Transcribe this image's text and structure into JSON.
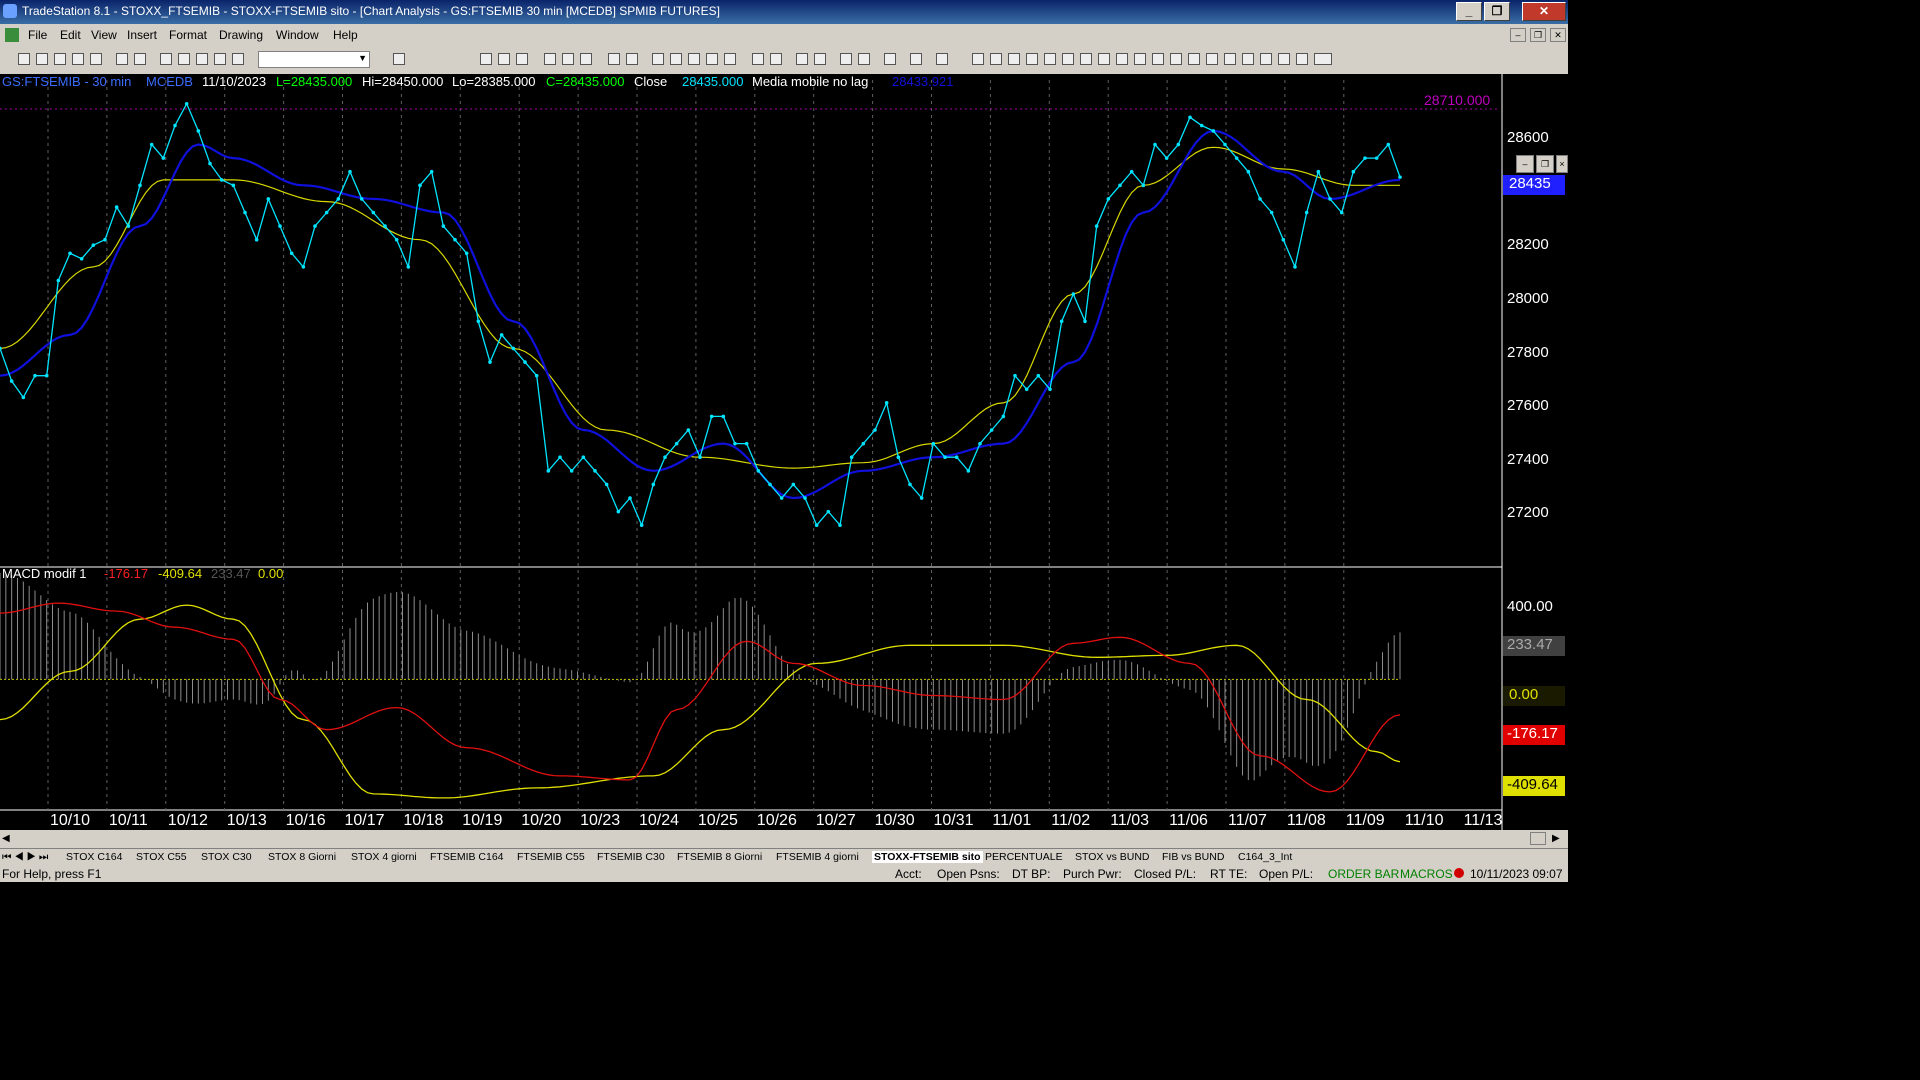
{
  "window": {
    "title": "TradeStation 8.1 - STOXX_FTSEMIB - STOXX-FTSEMIB sito - [Chart Analysis - GS:FTSEMIB  30 min  [MCEDB] SPMIB FUTURES]"
  },
  "menu": [
    "File",
    "Edit",
    "View",
    "Insert",
    "Format",
    "Drawing",
    "Window",
    "Help"
  ],
  "price_header": {
    "symbol": "GS:FTSEMIB - 30 min",
    "exchange": "MCEDB",
    "date": "11/10/2023",
    "last": "L=28435.000",
    "high": "Hi=28450.000",
    "low": "Lo=28385.000",
    "close": "C=28435.000",
    "close_label": "Close",
    "close_value": "28435.000",
    "ma_label": "Media mobile no lag",
    "ma_value": "28433.921"
  },
  "macd_header": {
    "label": "MACD modif 1",
    "v1": "-176.17",
    "v2": "-409.64",
    "v3": "233.47",
    "v4": "0.00"
  },
  "price_axis": {
    "labels": [
      "28600",
      "28400",
      "28200",
      "28000",
      "27800",
      "27600",
      "27400",
      "27200"
    ],
    "top_marker": "28710.000",
    "current": "28435"
  },
  "macd_axis": {
    "labels": [
      "400.00"
    ],
    "badges": {
      "hist": "233.47",
      "zero": "0.00",
      "macd": "-176.17",
      "signal": "-409.64"
    }
  },
  "time_axis": [
    "10/10",
    "10/11",
    "10/12",
    "10/13",
    "10/16",
    "10/17",
    "10/18",
    "10/19",
    "10/20",
    "10/23",
    "10/24",
    "10/25",
    "10/26",
    "10/27",
    "10/30",
    "10/31",
    "11/01",
    "11/02",
    "11/03",
    "11/06",
    "11/07",
    "11/08",
    "11/09",
    "11/10",
    "11/13"
  ],
  "tabs": [
    "STOX C164",
    "STOX C55",
    "STOX  C30",
    "STOX  8 Giorni",
    "STOX 4 giorni",
    "FTSEMIB C164",
    "FTSEMIB C55",
    "FTSEMIB C30",
    "FTSEMIB  8 Giorni",
    "FTSEMIB  4 giorni",
    "STOXX-FTSEMIB sito",
    "PERCENTUALE",
    "STOX vs BUND",
    "FIB vs BUND",
    "C164_3_Int"
  ],
  "active_tab": "STOXX-FTSEMIB sito",
  "status": {
    "help": "For Help, press F1",
    "acct": "Acct:",
    "open_psns": "Open Psns:",
    "dt_bp": "DT BP:",
    "purch_pwr": "Purch Pwr:",
    "closed_pl": "Closed P/L:",
    "rt_te": "RT TE:",
    "open_pl": "Open P/L:",
    "order_bar": "ORDER BAR",
    "macros": "MACROS",
    "datetime": "10/11/2023 09:07"
  },
  "colors": {
    "price": "#00e5ff",
    "ma_fast": "#1010dd",
    "ma_slow": "#d8d800",
    "macd": "#e01010",
    "signal": "#e0e000",
    "hist": "#8c8c8c",
    "header_symbol": "#3c6cff"
  },
  "chart_data": {
    "type": "line",
    "price_anchors": [
      [
        0,
        27800
      ],
      [
        1,
        27680
      ],
      [
        2,
        27620
      ],
      [
        3,
        27700
      ],
      [
        4,
        27700
      ],
      [
        5,
        28050
      ],
      [
        6,
        28150
      ],
      [
        7,
        28130
      ],
      [
        8,
        28180
      ],
      [
        9,
        28200
      ],
      [
        10,
        28320
      ],
      [
        11,
        28250
      ],
      [
        12,
        28400
      ],
      [
        13,
        28550
      ],
      [
        14,
        28500
      ],
      [
        15,
        28620
      ],
      [
        16,
        28700
      ],
      [
        17,
        28600
      ],
      [
        18,
        28480
      ],
      [
        19,
        28420
      ],
      [
        20,
        28400
      ],
      [
        21,
        28300
      ],
      [
        22,
        28200
      ],
      [
        23,
        28350
      ],
      [
        24,
        28250
      ],
      [
        25,
        28150
      ],
      [
        26,
        28100
      ],
      [
        27,
        28250
      ],
      [
        28,
        28300
      ],
      [
        29,
        28350
      ],
      [
        30,
        28450
      ],
      [
        31,
        28350
      ],
      [
        32,
        28300
      ],
      [
        33,
        28250
      ],
      [
        34,
        28200
      ],
      [
        35,
        28100
      ],
      [
        36,
        28400
      ],
      [
        37,
        28450
      ],
      [
        38,
        28250
      ],
      [
        39,
        28200
      ],
      [
        40,
        28150
      ],
      [
        41,
        27900
      ],
      [
        42,
        27750
      ],
      [
        43,
        27850
      ],
      [
        44,
        27800
      ],
      [
        45,
        27750
      ],
      [
        46,
        27700
      ],
      [
        47,
        27350
      ],
      [
        48,
        27400
      ],
      [
        49,
        27350
      ],
      [
        50,
        27400
      ],
      [
        51,
        27350
      ],
      [
        52,
        27300
      ],
      [
        53,
        27200
      ],
      [
        54,
        27250
      ],
      [
        55,
        27150
      ],
      [
        56,
        27300
      ],
      [
        57,
        27400
      ],
      [
        58,
        27450
      ],
      [
        59,
        27500
      ],
      [
        60,
        27400
      ],
      [
        61,
        27550
      ],
      [
        62,
        27550
      ],
      [
        63,
        27450
      ],
      [
        64,
        27450
      ],
      [
        65,
        27350
      ],
      [
        66,
        27300
      ],
      [
        67,
        27250
      ],
      [
        68,
        27300
      ],
      [
        69,
        27250
      ],
      [
        70,
        27150
      ],
      [
        71,
        27200
      ],
      [
        72,
        27150
      ],
      [
        73,
        27400
      ],
      [
        74,
        27450
      ],
      [
        75,
        27500
      ],
      [
        76,
        27600
      ],
      [
        77,
        27400
      ],
      [
        78,
        27300
      ],
      [
        79,
        27250
      ],
      [
        80,
        27450
      ],
      [
        81,
        27400
      ],
      [
        82,
        27400
      ],
      [
        83,
        27350
      ],
      [
        84,
        27450
      ],
      [
        85,
        27500
      ],
      [
        86,
        27550
      ],
      [
        87,
        27700
      ],
      [
        88,
        27650
      ],
      [
        89,
        27700
      ],
      [
        90,
        27650
      ],
      [
        91,
        27900
      ],
      [
        92,
        28000
      ],
      [
        93,
        27900
      ],
      [
        94,
        28250
      ],
      [
        95,
        28350
      ],
      [
        96,
        28400
      ],
      [
        97,
        28450
      ],
      [
        98,
        28400
      ],
      [
        99,
        28550
      ],
      [
        100,
        28500
      ],
      [
        101,
        28550
      ],
      [
        102,
        28650
      ],
      [
        103,
        28620
      ],
      [
        104,
        28600
      ],
      [
        105,
        28550
      ],
      [
        106,
        28500
      ],
      [
        107,
        28450
      ],
      [
        108,
        28350
      ],
      [
        109,
        28300
      ],
      [
        110,
        28200
      ],
      [
        111,
        28100
      ],
      [
        112,
        28300
      ],
      [
        113,
        28450
      ],
      [
        114,
        28350
      ],
      [
        115,
        28300
      ],
      [
        116,
        28450
      ],
      [
        117,
        28500
      ],
      [
        118,
        28500
      ],
      [
        119,
        28550
      ],
      [
        120,
        28430
      ]
    ],
    "ma_fast_anchors": [
      [
        0,
        27700
      ],
      [
        6,
        27850
      ],
      [
        12,
        28250
      ],
      [
        17,
        28550
      ],
      [
        20,
        28500
      ],
      [
        26,
        28400
      ],
      [
        32,
        28350
      ],
      [
        38,
        28300
      ],
      [
        44,
        27900
      ],
      [
        50,
        27500
      ],
      [
        56,
        27350
      ],
      [
        62,
        27450
      ],
      [
        68,
        27250
      ],
      [
        74,
        27350
      ],
      [
        80,
        27400
      ],
      [
        86,
        27450
      ],
      [
        92,
        27750
      ],
      [
        98,
        28300
      ],
      [
        104,
        28600
      ],
      [
        110,
        28450
      ],
      [
        114,
        28350
      ],
      [
        120,
        28420
      ]
    ],
    "ma_slow_anchors": [
      [
        0,
        27800
      ],
      [
        8,
        28100
      ],
      [
        14,
        28420
      ],
      [
        20,
        28420
      ],
      [
        28,
        28340
      ],
      [
        36,
        28200
      ],
      [
        44,
        27800
      ],
      [
        52,
        27500
      ],
      [
        60,
        27400
      ],
      [
        68,
        27360
      ],
      [
        74,
        27380
      ],
      [
        80,
        27450
      ],
      [
        86,
        27600
      ],
      [
        92,
        28000
      ],
      [
        98,
        28400
      ],
      [
        104,
        28540
      ],
      [
        110,
        28460
      ],
      [
        116,
        28400
      ],
      [
        120,
        28400
      ]
    ],
    "macd_anchors": [
      [
        0,
        330
      ],
      [
        5,
        380
      ],
      [
        10,
        340
      ],
      [
        15,
        260
      ],
      [
        20,
        200
      ],
      [
        24,
        -100
      ],
      [
        28,
        -250
      ],
      [
        34,
        -140
      ],
      [
        40,
        -340
      ],
      [
        48,
        -480
      ],
      [
        54,
        -500
      ],
      [
        58,
        -150
      ],
      [
        64,
        190
      ],
      [
        68,
        80
      ],
      [
        74,
        -30
      ],
      [
        80,
        -80
      ],
      [
        86,
        -100
      ],
      [
        92,
        180
      ],
      [
        96,
        210
      ],
      [
        102,
        80
      ],
      [
        108,
        -380
      ],
      [
        114,
        -560
      ],
      [
        120,
        -176
      ]
    ],
    "signal_anchors": [
      [
        0,
        -200
      ],
      [
        6,
        40
      ],
      [
        12,
        300
      ],
      [
        16,
        370
      ],
      [
        20,
        300
      ],
      [
        26,
        -200
      ],
      [
        32,
        -570
      ],
      [
        38,
        -590
      ],
      [
        46,
        -540
      ],
      [
        56,
        -480
      ],
      [
        62,
        -250
      ],
      [
        70,
        80
      ],
      [
        78,
        170
      ],
      [
        86,
        170
      ],
      [
        94,
        110
      ],
      [
        100,
        120
      ],
      [
        106,
        170
      ],
      [
        112,
        -100
      ],
      [
        118,
        -360
      ],
      [
        120,
        -410
      ]
    ],
    "macd_range": [
      -650,
      500
    ],
    "price_range": [
      27000,
      28780
    ]
  }
}
